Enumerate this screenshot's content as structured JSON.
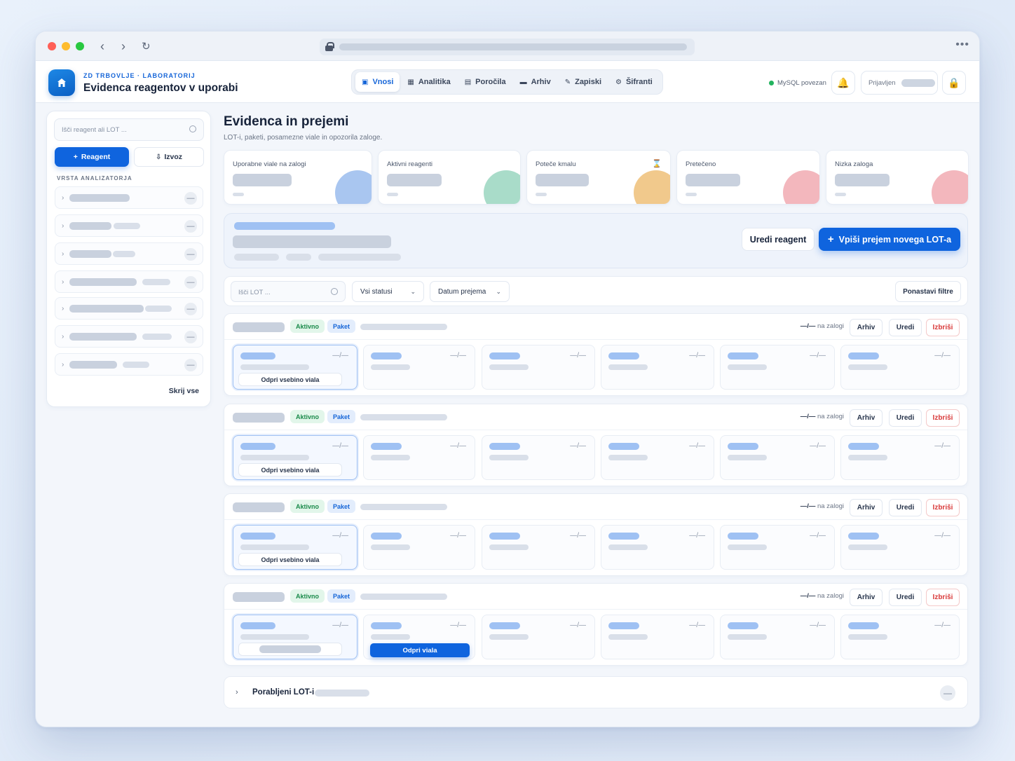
{
  "app": {
    "org": "ZD TRBOVLJE · LABORATORIJ",
    "title": "Evidenca reagentov v uporabi"
  },
  "nav": {
    "tabs": [
      {
        "label": "Vnosi",
        "icon": "inbox-icon",
        "active": true
      },
      {
        "label": "Analitika",
        "icon": "chart-icon"
      },
      {
        "label": "Poročila",
        "icon": "document-icon"
      },
      {
        "label": "Arhiv",
        "icon": "archive-icon"
      },
      {
        "label": "Zapiski",
        "icon": "pencil-icon"
      },
      {
        "label": "Šifranti",
        "icon": "gear-icon"
      }
    ]
  },
  "status": {
    "db": "MySQL povezan",
    "db_color": "#22b35e",
    "user_label": "Prijavljen"
  },
  "sidebar": {
    "search_placeholder": "Išči reagent ali LOT ...",
    "add_label": "Reagent",
    "export_label": "Izvoz",
    "section_label": "VRSTA ANALIZATORJA",
    "hide_all": "Skrij vse"
  },
  "main": {
    "title": "Evidenca in prejemi",
    "subtitle": "LOT-i, paketi, posamezne viale in opozorila zaloge."
  },
  "kpis": [
    {
      "label": "Uporabne viale na zalogi",
      "color": "#a9c6f0"
    },
    {
      "label": "Aktivni reagenti",
      "color": "#a9dcc9"
    },
    {
      "label": "Poteče kmalu",
      "color": "#f1c98c",
      "icon": "hourglass-icon"
    },
    {
      "label": "Pretečeno",
      "color": "#f3b7bd"
    },
    {
      "label": "Nizka zaloga",
      "color": "#f3b7bd"
    }
  ],
  "hero": {
    "edit_label": "Uredi reagent",
    "new_lot_label": "Vpiši prejem novega LOT-a"
  },
  "filters": {
    "search_placeholder": "Išči LOT ...",
    "status_select": "Vsi statusi",
    "sort_select": "Datum prejema",
    "reset_label": "Ponastavi filtre"
  },
  "lot_common": {
    "status_badge": "Aktivno",
    "type_badge": "Paket",
    "stock_value": "—/—",
    "stock_suffix": "na zalogi",
    "archive_label": "Arhiv",
    "edit_label": "Uredi",
    "delete_label": "Izbriši",
    "vial_dash": "—/—",
    "open_vial_content": "Odpri vsebino viala",
    "open_vials": "Odpri viala"
  },
  "consumed": {
    "label": "Porabljeni LOT-i"
  }
}
